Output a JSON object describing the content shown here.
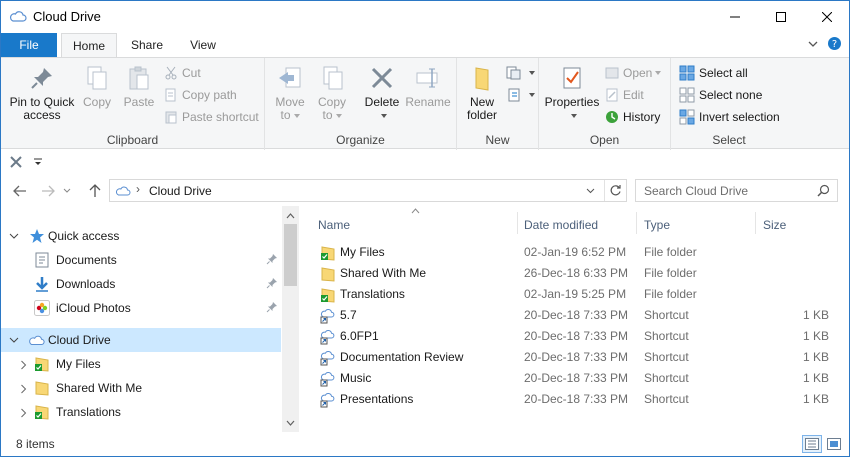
{
  "window": {
    "title": "Cloud Drive"
  },
  "tabs": [
    "File",
    "Home",
    "Share",
    "View"
  ],
  "ribbon": {
    "clipboard": {
      "label": "Clipboard",
      "pin": "Pin to Quick access",
      "copy": "Copy",
      "paste": "Paste",
      "cut": "Cut",
      "copy_path": "Copy path",
      "paste_shortcut": "Paste shortcut"
    },
    "organize": {
      "label": "Organize",
      "move_to": "Move to",
      "copy_to": "Copy to",
      "delete": "Delete",
      "rename": "Rename"
    },
    "new": {
      "label": "New",
      "new_folder": "New folder"
    },
    "open": {
      "label": "Open",
      "properties": "Properties",
      "open": "Open",
      "edit": "Edit",
      "history": "History"
    },
    "select": {
      "label": "Select",
      "select_all": "Select all",
      "select_none": "Select none",
      "invert": "Invert selection"
    }
  },
  "address": {
    "crumbs": [
      "Cloud Drive"
    ],
    "search_placeholder": "Search Cloud Drive"
  },
  "nav": {
    "quick_access": "Quick access",
    "items": [
      {
        "label": "Documents",
        "pinned": true
      },
      {
        "label": "Downloads",
        "pinned": true
      },
      {
        "label": "iCloud Photos",
        "pinned": true
      }
    ],
    "cloud_drive": "Cloud Drive",
    "children": [
      {
        "label": "My Files",
        "synced": true
      },
      {
        "label": "Shared With Me",
        "synced": false
      },
      {
        "label": "Translations",
        "synced": true
      }
    ]
  },
  "columns": {
    "name": "Name",
    "date": "Date modified",
    "type": "Type",
    "size": "Size"
  },
  "files": [
    {
      "name": "My Files",
      "date": "02-Jan-19 6:52 PM",
      "type": "File folder",
      "size": "",
      "kind": "folder-synced"
    },
    {
      "name": "Shared With Me",
      "date": "26-Dec-18 6:33 PM",
      "type": "File folder",
      "size": "",
      "kind": "folder"
    },
    {
      "name": "Translations",
      "date": "02-Jan-19 5:25 PM",
      "type": "File folder",
      "size": "",
      "kind": "folder-synced"
    },
    {
      "name": "5.7",
      "date": "20-Dec-18 7:33 PM",
      "type": "Shortcut",
      "size": "1 KB",
      "kind": "shortcut"
    },
    {
      "name": "6.0FP1",
      "date": "20-Dec-18 7:33 PM",
      "type": "Shortcut",
      "size": "1 KB",
      "kind": "shortcut"
    },
    {
      "name": "Documentation Review",
      "date": "20-Dec-18 7:33 PM",
      "type": "Shortcut",
      "size": "1 KB",
      "kind": "shortcut"
    },
    {
      "name": "Music",
      "date": "20-Dec-18 7:33 PM",
      "type": "Shortcut",
      "size": "1 KB",
      "kind": "shortcut"
    },
    {
      "name": "Presentations",
      "date": "20-Dec-18 7:33 PM",
      "type": "Shortcut",
      "size": "1 KB",
      "kind": "shortcut"
    }
  ],
  "status": {
    "count": "8 items"
  },
  "colors": {
    "accent": "#1979ca",
    "selection": "#cce8ff",
    "folder": "#f8d775",
    "sync_check": "#1c9a2f"
  }
}
